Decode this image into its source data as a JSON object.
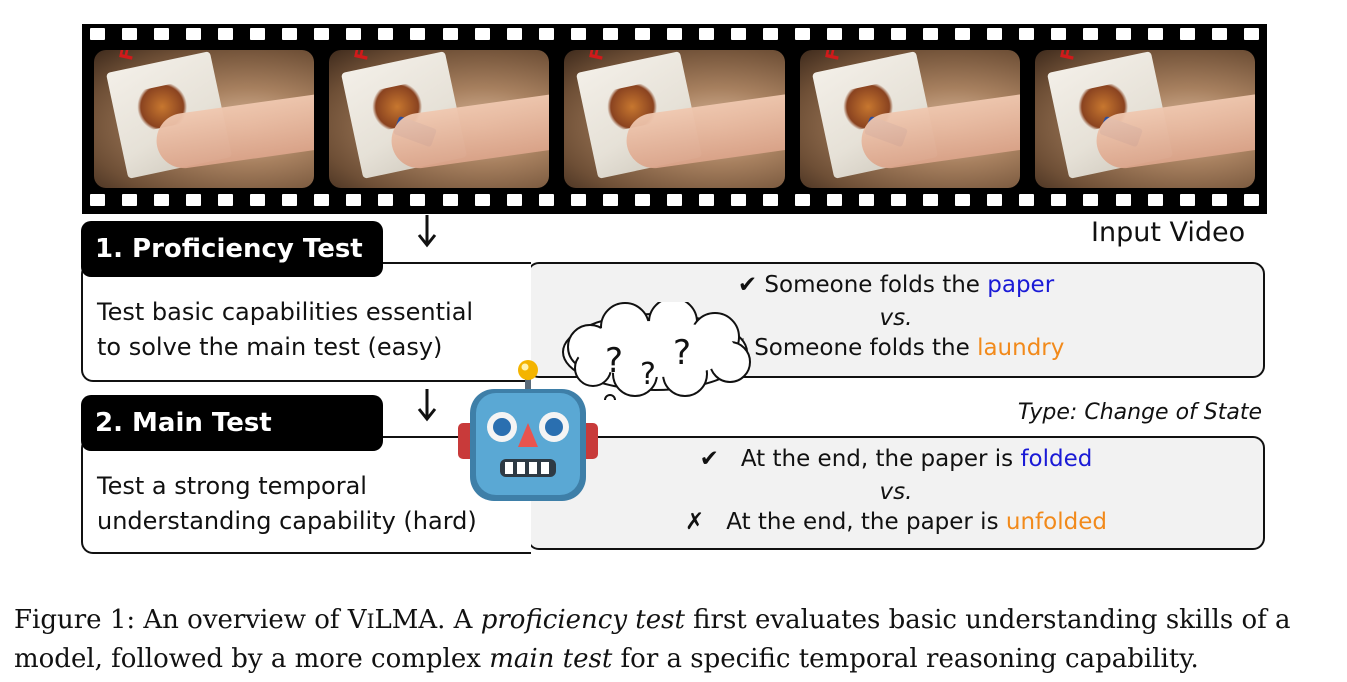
{
  "input_video_label": "Input Video",
  "proficiency": {
    "title": "1. Proficiency Test",
    "desc_line1": "Test basic capabilities essential",
    "desc_line2": "to solve the main test (easy)",
    "correct_prefix": "✔ Someone folds the ",
    "correct_word": "paper",
    "vs": "vs.",
    "wrong_prefix": "✗ Someone folds the ",
    "wrong_word": "laundry"
  },
  "main": {
    "title": "2. Main Test",
    "desc_line1": "Test a strong temporal",
    "desc_line2": "understanding capability (hard)",
    "type_label": "Type:",
    "type_value": "Change of State",
    "correct_mark": "✔",
    "correct_prefix": "At the end, the paper is ",
    "correct_word": "folded",
    "vs": "vs.",
    "wrong_mark": "✗",
    "wrong_prefix": "At the end, the paper is ",
    "wrong_word": "unfolded"
  },
  "thought": {
    "q1": "?",
    "q2": "?",
    "q3": "?"
  },
  "frame_overlay_text": [
    "FRE",
    "FRE",
    "FRE",
    "FRE",
    "FRE"
  ],
  "colors": {
    "correct": "#1a1ad6",
    "wrong": "#f28a1b",
    "black": "#000000"
  },
  "caption": {
    "part1": "Figure 1: An overview of V",
    "part2": "I",
    "part3": "LMA. A ",
    "part4": "proficiency test",
    "part5": " first evaluates basic understanding skills of a",
    "part6": "model, followed by a more complex ",
    "part7": "main test",
    "part8": " for a specific temporal reasoning capability."
  }
}
